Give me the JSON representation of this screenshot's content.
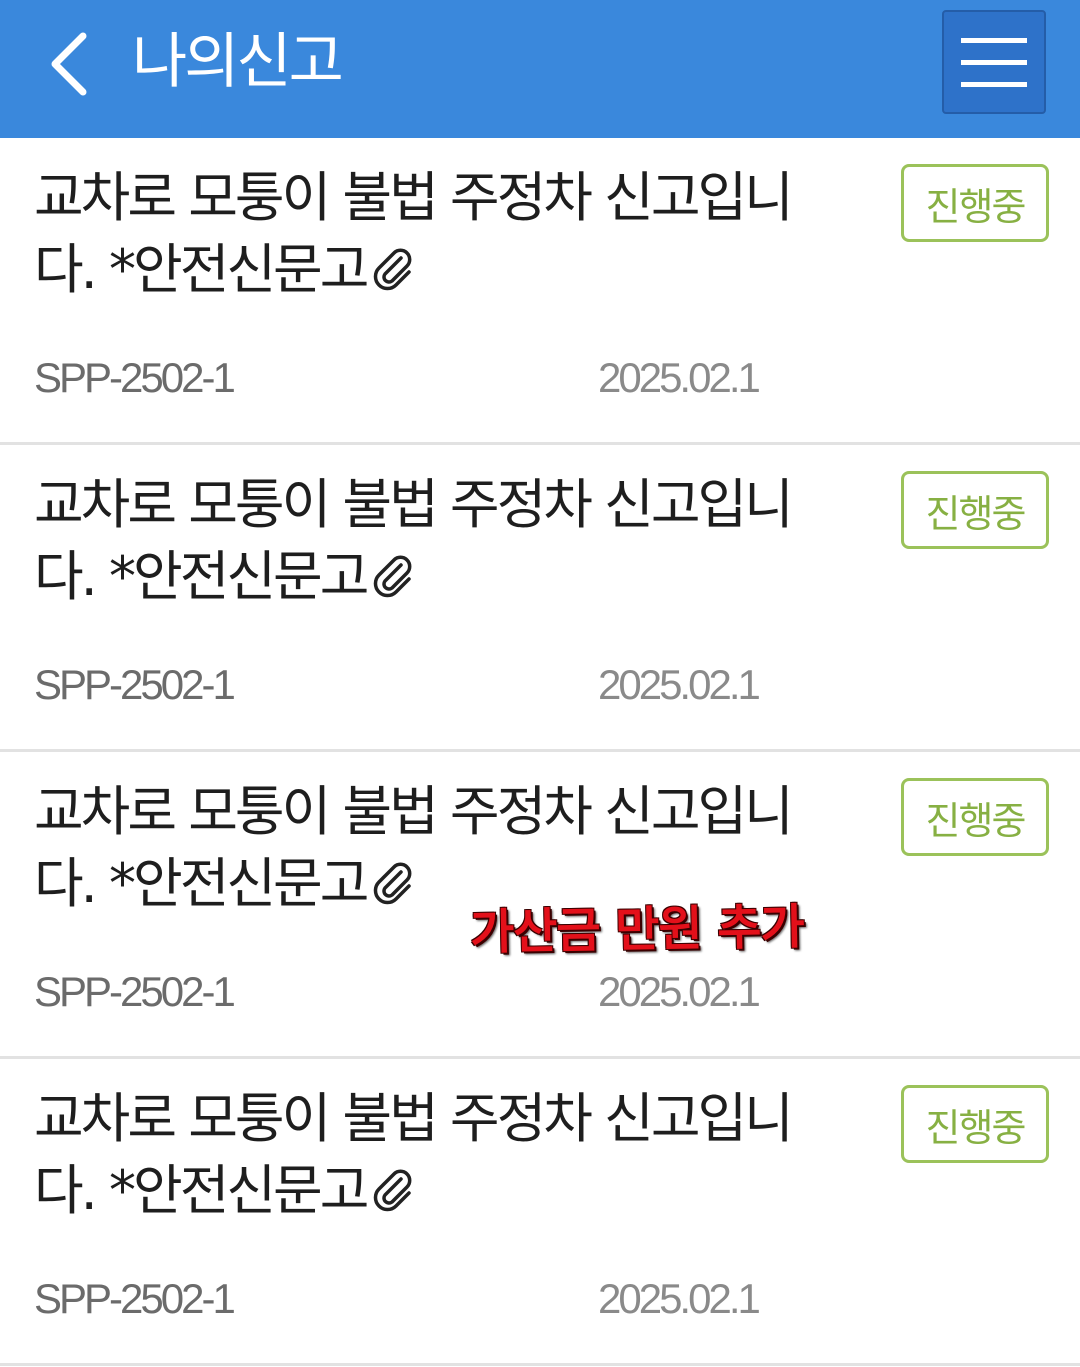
{
  "header": {
    "title": "나의신고",
    "back_icon": "chevron-left-icon",
    "menu_icon": "hamburger-menu-icon",
    "background_color": "#3a88dc"
  },
  "reports": [
    {
      "title": "교차로 모퉁이 불법 주정차 신고입니다. *안전신문고",
      "has_attachment": true,
      "status": "진행중",
      "id": "SPP-2502-1",
      "date": "2025.02.1"
    },
    {
      "title": "교차로 모퉁이 불법 주정차 신고입니다. *안전신문고",
      "has_attachment": true,
      "status": "진행중",
      "id": "SPP-2502-1",
      "date": "2025.02.1"
    },
    {
      "title": "교차로 모퉁이 불법 주정차 신고입니다. *안전신문고",
      "has_attachment": true,
      "status": "진행중",
      "id": "SPP-2502-1",
      "date": "2025.02.1"
    },
    {
      "title": "교차로 모퉁이 불법 주정차 신고입니다. *안전신문고",
      "has_attachment": true,
      "status": "진행중",
      "id": "SPP-2502-1",
      "date": "2025.02.1"
    }
  ],
  "overlay": {
    "text": "가산금 만원 추가",
    "color": "#e3101a"
  },
  "colors": {
    "status_border": "#9bc25a",
    "status_text": "#87b043",
    "divider": "#e2e2e2"
  }
}
